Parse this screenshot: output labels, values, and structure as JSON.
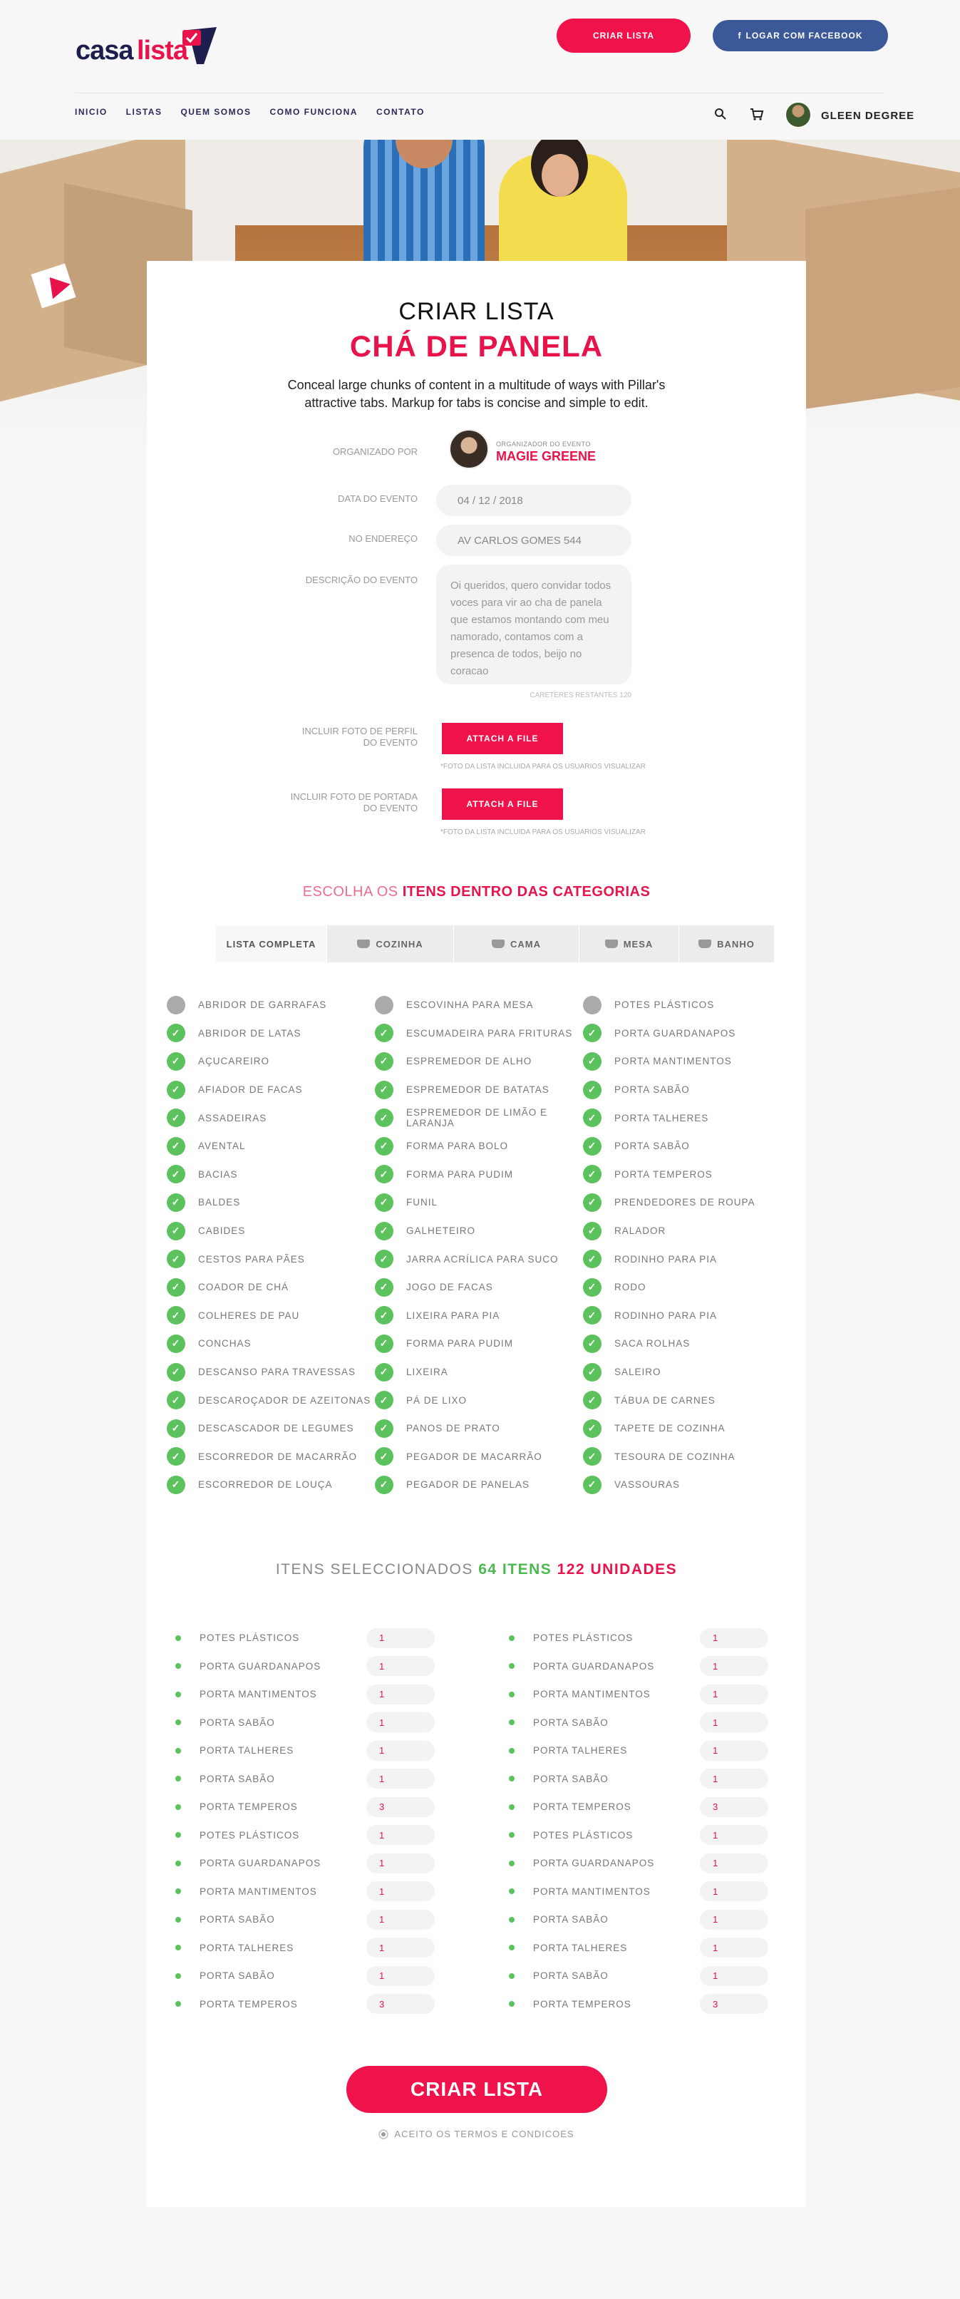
{
  "header": {
    "logo_part1": "casa",
    "logo_part2": "lista",
    "create_list_button": "CRIAR LISTA",
    "facebook_button": "LOGAR COM FACEBOOK",
    "facebook_icon": "f",
    "nav": [
      "INICIO",
      "LISTAS",
      "QUEM SOMOS",
      "COMO FUNCIONA",
      "CONTATO"
    ],
    "user_name": "GLEEN DEGREE"
  },
  "form": {
    "title": "CRIAR LISTA",
    "subtitle": "CHÁ DE PANELA",
    "intro": "Conceal large chunks of content in a multitude of ways with Pillar's attractive tabs. Markup for tabs is concise and simple to edit.",
    "organizer_label": "ORGANIZADO POR",
    "organizer_small": "ORGANIZADOR DO EVENTO",
    "organizer_name": "MAGIE GREENE",
    "date_label": "DATA DO EVENTO",
    "date_value": "04 / 12 / 2018",
    "address_label": "NO ENDEREÇO",
    "address_value": "AV CARLOS GOMES 544",
    "description_label": "DESCRIÇÃO DO EVENTO",
    "description_value": "Oi queridos, quero convidar todos voces para vir ao cha de panela que estamos montando com meu namorado, contamos com a presenca de todos, beijo no coracao",
    "chars_remaining": "CARETERES RESTANTES 120",
    "profile_photo_label": "INCLUIR FOTO DE PERFIL DO EVENTO",
    "cover_photo_label": "INCLUIR FOTO DE PORTADA DO EVENTO",
    "attach_label": "ATTACH A FILE",
    "photo_note": "*FOTO DA LISTA INCLUIDA PARA OS USUARIOS VISUALIZAR"
  },
  "categories": {
    "title_part1": "ESCOLHA OS",
    "title_part2": "ITENS DENTRO DAS CATEGORIAS",
    "tabs": [
      "LISTA COMPLETA",
      "COZINHA",
      "CAMA",
      "MESA",
      "BANHO"
    ],
    "columns": [
      [
        {
          "label": "ABRIDOR DE GARRAFAS",
          "checked": false
        },
        {
          "label": "ABRIDOR DE LATAS",
          "checked": true
        },
        {
          "label": "AÇUCAREIRO",
          "checked": true
        },
        {
          "label": "AFIADOR DE FACAS",
          "checked": true
        },
        {
          "label": "ASSADEIRAS",
          "checked": true
        },
        {
          "label": "AVENTAL",
          "checked": true
        },
        {
          "label": "BACIAS",
          "checked": true
        },
        {
          "label": "BALDES",
          "checked": true
        },
        {
          "label": "CABIDES",
          "checked": true
        },
        {
          "label": "CESTOS PARA PÃES",
          "checked": true
        },
        {
          "label": "COADOR DE CHÁ",
          "checked": true
        },
        {
          "label": "COLHERES DE PAU",
          "checked": true
        },
        {
          "label": "CONCHAS",
          "checked": true
        },
        {
          "label": "DESCANSO PARA TRAVESSAS",
          "checked": true
        },
        {
          "label": "DESCAROÇADOR DE AZEITONAS",
          "checked": true
        },
        {
          "label": "DESCASCADOR DE LEGUMES",
          "checked": true
        },
        {
          "label": "ESCORREDOR DE MACARRÃO",
          "checked": true
        },
        {
          "label": "ESCORREDOR DE LOUÇA",
          "checked": true
        }
      ],
      [
        {
          "label": "ESCOVINHA PARA MESA",
          "checked": false
        },
        {
          "label": "ESCUMADEIRA PARA FRITURAS",
          "checked": true
        },
        {
          "label": "ESPREMEDOR DE ALHO",
          "checked": true
        },
        {
          "label": "ESPREMEDOR DE BATATAS",
          "checked": true
        },
        {
          "label": "ESPREMEDOR DE LIMÃO E LARANJA",
          "checked": true
        },
        {
          "label": "FORMA PARA BOLO",
          "checked": true
        },
        {
          "label": "FORMA PARA PUDIM",
          "checked": true
        },
        {
          "label": "FUNIL",
          "checked": true
        },
        {
          "label": "GALHETEIRO",
          "checked": true
        },
        {
          "label": "JARRA ACRÍLICA PARA SUCO",
          "checked": true
        },
        {
          "label": "JOGO DE FACAS",
          "checked": true
        },
        {
          "label": "LIXEIRA PARA PIA",
          "checked": true
        },
        {
          "label": "FORMA PARA PUDIM",
          "checked": true
        },
        {
          "label": "LIXEIRA",
          "checked": true
        },
        {
          "label": "PÁ DE LIXO",
          "checked": true
        },
        {
          "label": "PANOS DE PRATO",
          "checked": true
        },
        {
          "label": "PEGADOR DE MACARRÃO",
          "checked": true
        },
        {
          "label": "PEGADOR DE PANELAS",
          "checked": true
        }
      ],
      [
        {
          "label": "POTES PLÁSTICOS",
          "checked": false
        },
        {
          "label": "PORTA GUARDANAPOS",
          "checked": true
        },
        {
          "label": "PORTA MANTIMENTOS",
          "checked": true
        },
        {
          "label": "PORTA SABÃO",
          "checked": true
        },
        {
          "label": "PORTA TALHERES",
          "checked": true
        },
        {
          "label": "PORTA SABÃO",
          "checked": true
        },
        {
          "label": "PORTA TEMPEROS",
          "checked": true
        },
        {
          "label": "PRENDEDORES DE ROUPA",
          "checked": true
        },
        {
          "label": "RALADOR",
          "checked": true
        },
        {
          "label": "RODINHO PARA PIA",
          "checked": true
        },
        {
          "label": "RODO",
          "checked": true
        },
        {
          "label": "RODINHO PARA PIA",
          "checked": true
        },
        {
          "label": "SACA ROLHAS",
          "checked": true
        },
        {
          "label": "SALEIRO",
          "checked": true
        },
        {
          "label": "TÁBUA DE CARNES",
          "checked": true
        },
        {
          "label": "TAPETE DE COZINHA",
          "checked": true
        },
        {
          "label": "TESOURA DE COZINHA",
          "checked": true
        },
        {
          "label": "VASSOURAS",
          "checked": true
        }
      ]
    ]
  },
  "selected": {
    "title_part1": "ITENS SELECCIONADOS",
    "items_count": "64 ITENS",
    "units_count": "122 UNIDADES",
    "columns": [
      [
        {
          "name": "POTES PLÁSTICOS",
          "qty": "1"
        },
        {
          "name": "PORTA GUARDANAPOS",
          "qty": "1"
        },
        {
          "name": "PORTA MANTIMENTOS",
          "qty": "1"
        },
        {
          "name": "PORTA SABÃO",
          "qty": "1"
        },
        {
          "name": "PORTA TALHERES",
          "qty": "1"
        },
        {
          "name": "PORTA SABÃO",
          "qty": "1"
        },
        {
          "name": "PORTA TEMPEROS",
          "qty": "3"
        },
        {
          "name": "POTES PLÁSTICOS",
          "qty": "1"
        },
        {
          "name": "PORTA GUARDANAPOS",
          "qty": "1"
        },
        {
          "name": "PORTA MANTIMENTOS",
          "qty": "1"
        },
        {
          "name": "PORTA SABÃO",
          "qty": "1"
        },
        {
          "name": "PORTA TALHERES",
          "qty": "1"
        },
        {
          "name": "PORTA SABÃO",
          "qty": "1"
        },
        {
          "name": "PORTA TEMPEROS",
          "qty": "3"
        }
      ],
      [
        {
          "name": "POTES PLÁSTICOS",
          "qty": "1"
        },
        {
          "name": "PORTA GUARDANAPOS",
          "qty": "1"
        },
        {
          "name": "PORTA MANTIMENTOS",
          "qty": "1"
        },
        {
          "name": "PORTA SABÃO",
          "qty": "1"
        },
        {
          "name": "PORTA TALHERES",
          "qty": "1"
        },
        {
          "name": "PORTA SABÃO",
          "qty": "1"
        },
        {
          "name": "PORTA TEMPEROS",
          "qty": "3"
        },
        {
          "name": "POTES PLÁSTICOS",
          "qty": "1"
        },
        {
          "name": "PORTA GUARDANAPOS",
          "qty": "1"
        },
        {
          "name": "PORTA MANTIMENTOS",
          "qty": "1"
        },
        {
          "name": "PORTA SABÃO",
          "qty": "1"
        },
        {
          "name": "PORTA TALHERES",
          "qty": "1"
        },
        {
          "name": "PORTA SABÃO",
          "qty": "1"
        },
        {
          "name": "PORTA TEMPEROS",
          "qty": "3"
        }
      ]
    ]
  },
  "footer": {
    "create_button": "CRIAR LISTA",
    "terms": "ACEITO OS TERMOS E CONDICOES"
  },
  "colors": {
    "accent": "#f0124a",
    "brand_dark": "#1e1e4e",
    "facebook": "#3b5998",
    "check": "#5cc25d"
  }
}
